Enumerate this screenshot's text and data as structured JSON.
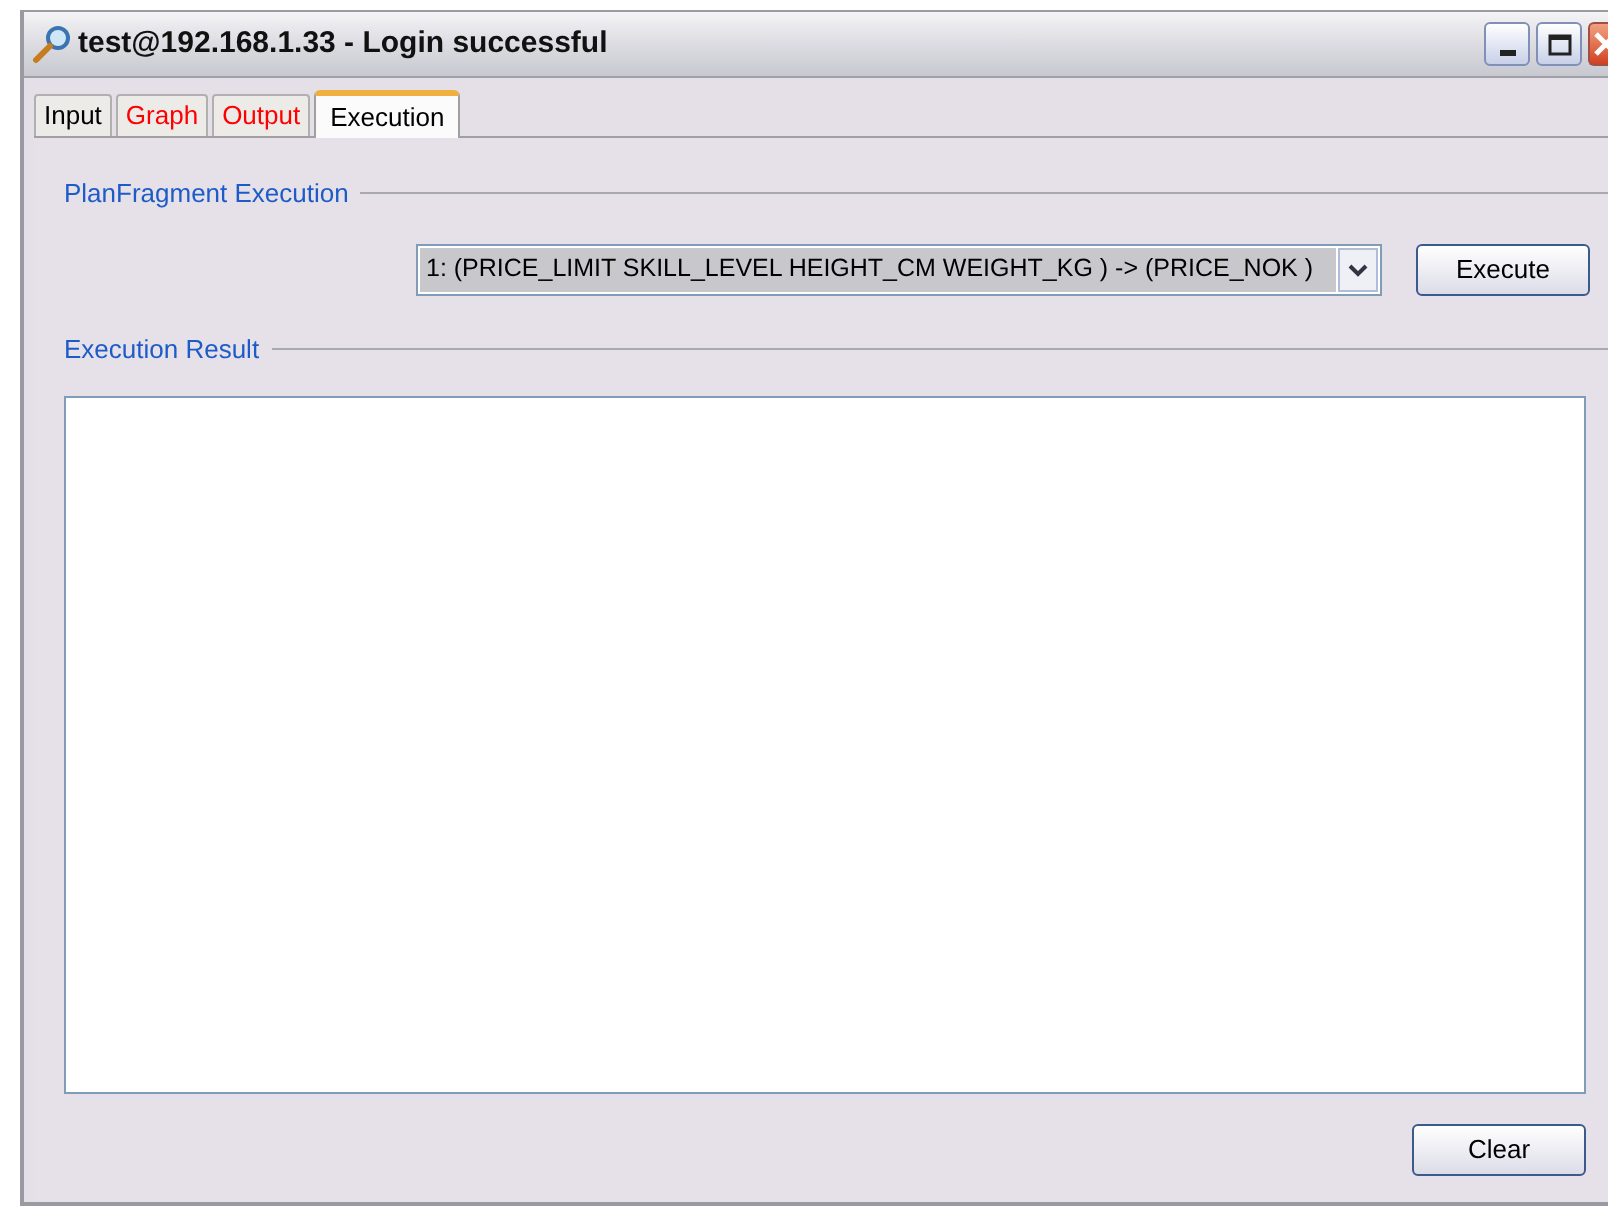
{
  "window": {
    "title": "test@192.168.1.33 - Login successful"
  },
  "tabs": [
    {
      "label": "Input",
      "selected": false,
      "color": "#000000"
    },
    {
      "label": "Graph",
      "selected": false,
      "color": "#ff0000"
    },
    {
      "label": "Output",
      "selected": false,
      "color": "#ff0000"
    },
    {
      "label": "Execution",
      "selected": true,
      "color": "#000000"
    }
  ],
  "plan_section": {
    "title": "PlanFragment Execution",
    "combo_value": "1: (PRICE_LIMIT SKILL_LEVEL HEIGHT_CM WEIGHT_KG ) -> (PRICE_NOK )",
    "button": "Execute"
  },
  "result_section": {
    "title": "Execution Result",
    "button": "Clear"
  }
}
